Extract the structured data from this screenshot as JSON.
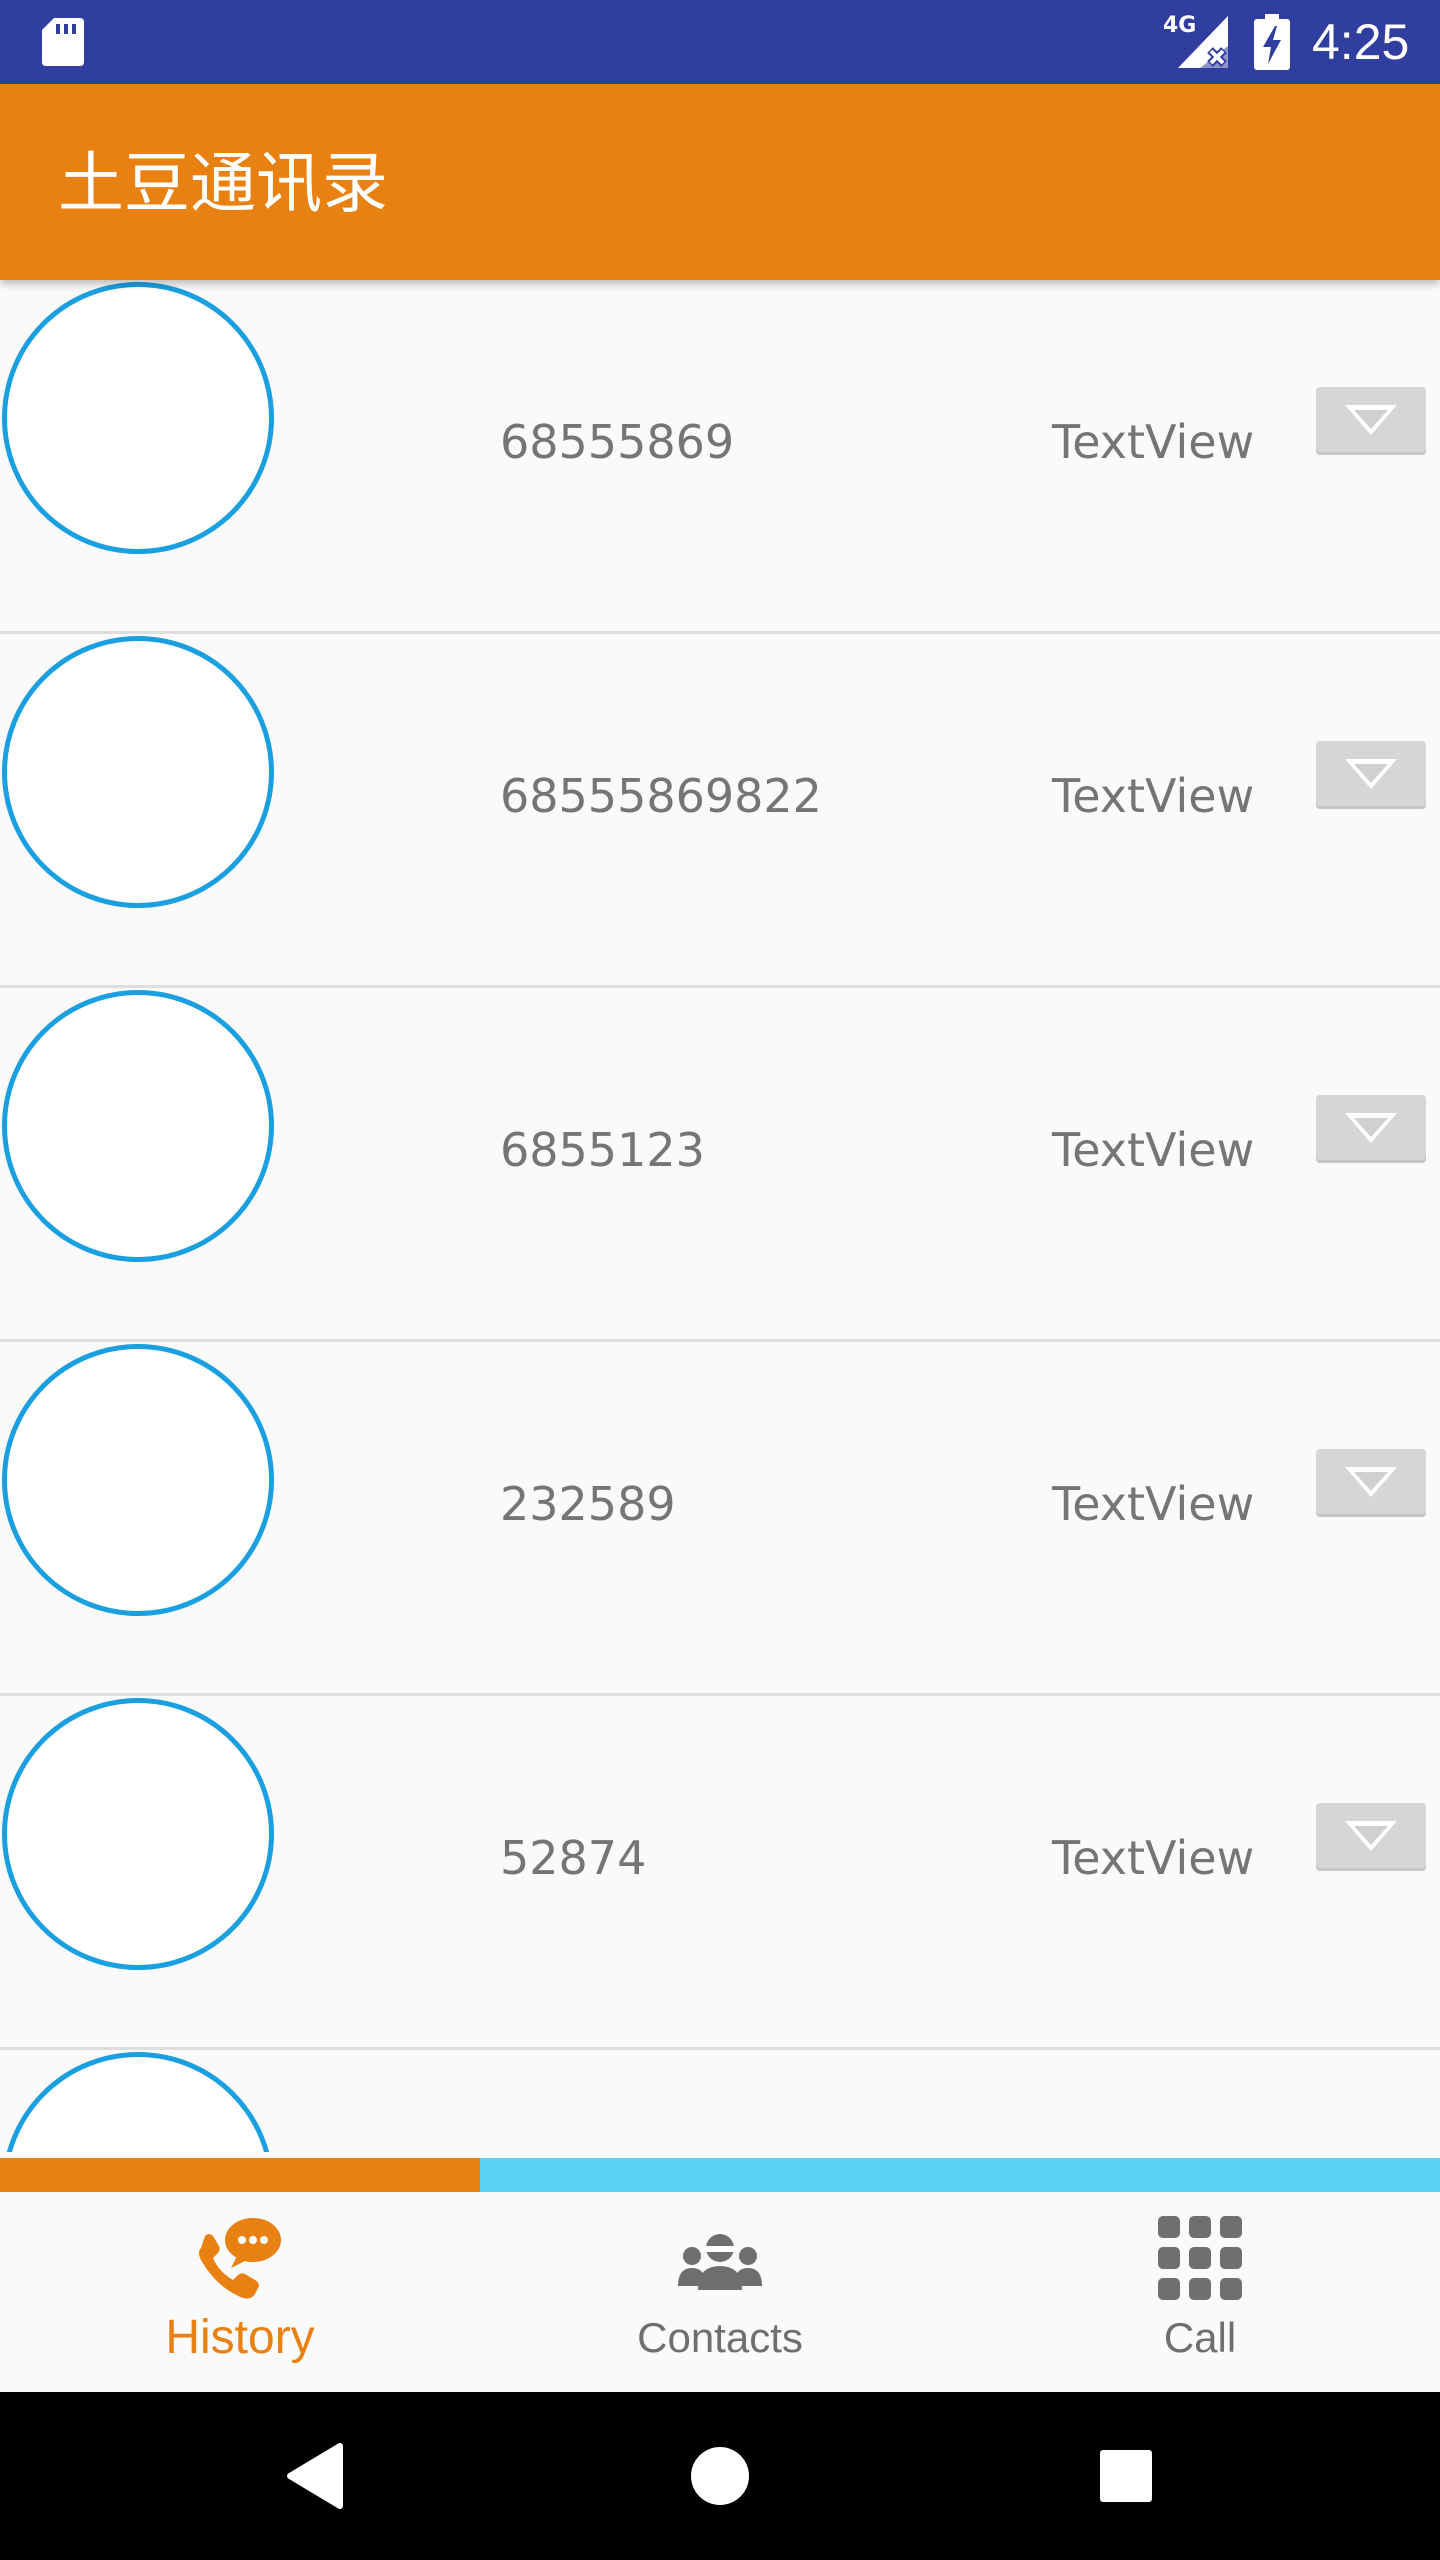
{
  "status_bar": {
    "network": "4G",
    "time": "4:25",
    "background": "#303f9f",
    "icons": [
      "sd-card-icon",
      "signal-icon",
      "battery-charging-icon"
    ]
  },
  "app_bar": {
    "title": "土豆通讯录",
    "background": "#e98012"
  },
  "contacts": [
    {
      "number": "68555869",
      "label": "TextView"
    },
    {
      "number": "68555869822",
      "label": "TextView"
    },
    {
      "number": "6855123",
      "label": "TextView"
    },
    {
      "number": "232589",
      "label": "TextView"
    },
    {
      "number": "52874",
      "label": "TextView"
    },
    {
      "number": "",
      "label": ""
    }
  ],
  "colors": {
    "accent": "#e98012",
    "avatar_ring": "#1a9fe0",
    "tab_indicator_inactive": "#59d1f4",
    "text_secondary": "#757575"
  },
  "tabs": [
    {
      "label": "History",
      "icon": "phone-chat-icon",
      "active": true
    },
    {
      "label": "Contacts",
      "icon": "people-group-icon",
      "active": false
    },
    {
      "label": "Call",
      "icon": "dialpad-grid-icon",
      "active": false
    }
  ],
  "nav_bar": {
    "buttons": [
      "back-icon",
      "home-icon",
      "recents-icon"
    ]
  }
}
